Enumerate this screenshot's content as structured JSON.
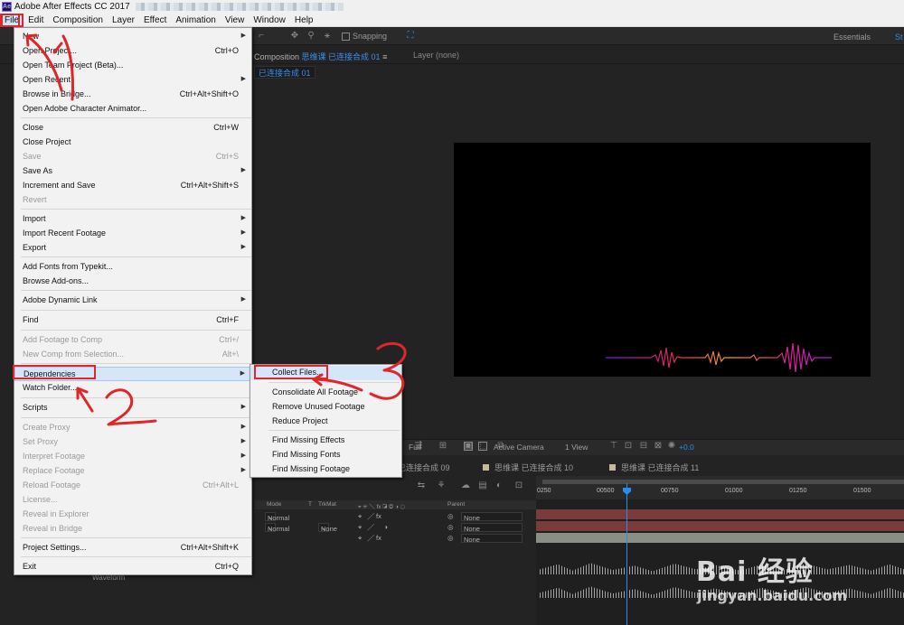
{
  "window": {
    "title": "Adobe After Effects CC 2017",
    "logo": "Ae"
  },
  "menubar": [
    "File",
    "Edit",
    "Composition",
    "Layer",
    "Effect",
    "Animation",
    "View",
    "Window",
    "Help"
  ],
  "toolbar": {
    "snapping": "Snapping",
    "workspace": "Essentials",
    "workspace_next": "St"
  },
  "comp_panel": {
    "tab_prefix": "Composition",
    "tab_name": "思维课 已连接合成 01",
    "menu_icon": "≡",
    "layer_tab": "Layer (none)",
    "sub_tab": "已连接合成 01"
  },
  "viewer_controls": {
    "resolution": "Full",
    "camera": "Active Camera",
    "views": "1 View",
    "exposure": "+0.0"
  },
  "timeline": {
    "tabs": [
      "已连接合成 09",
      "思维课 已连接合成 10",
      "思维课 已连接合成 11"
    ],
    "columns": {
      "mode": "Mode",
      "t": "T",
      "trkmat": "TrkMat",
      "parent": "Parent"
    },
    "rows": [
      {
        "mode": "Normal",
        "trkmat": "",
        "parent": "None"
      },
      {
        "mode": "Normal",
        "trkmat": "None",
        "parent": "None"
      },
      {
        "mode": "",
        "trkmat": "",
        "parent": "None"
      }
    ],
    "ruler": [
      "0250",
      "00500",
      "00750",
      "01000",
      "01250",
      "01500"
    ],
    "waveform_label": "Waveform"
  },
  "file_menu": {
    "items": [
      {
        "label": "New",
        "shortcut": "",
        "submenu": true,
        "disabled": false
      },
      {
        "label": "Open Project...",
        "shortcut": "Ctrl+O",
        "submenu": false,
        "disabled": false
      },
      {
        "label": "Open Team Project (Beta)...",
        "shortcut": "",
        "submenu": false,
        "disabled": false
      },
      {
        "label": "Open Recent",
        "shortcut": "",
        "submenu": true,
        "disabled": false
      },
      {
        "label": "Browse in Bridge...",
        "shortcut": "Ctrl+Alt+Shift+O",
        "submenu": false,
        "disabled": false
      },
      {
        "label": "Open Adobe Character Animator...",
        "shortcut": "",
        "submenu": false,
        "disabled": false
      },
      {
        "label": "Close",
        "shortcut": "Ctrl+W",
        "submenu": false,
        "disabled": false
      },
      {
        "label": "Close Project",
        "shortcut": "",
        "submenu": false,
        "disabled": false
      },
      {
        "label": "Save",
        "shortcut": "Ctrl+S",
        "submenu": false,
        "disabled": true
      },
      {
        "label": "Save As",
        "shortcut": "",
        "submenu": true,
        "disabled": false
      },
      {
        "label": "Increment and Save",
        "shortcut": "Ctrl+Alt+Shift+S",
        "submenu": false,
        "disabled": false
      },
      {
        "label": "Revert",
        "shortcut": "",
        "submenu": false,
        "disabled": true
      },
      {
        "label": "Import",
        "shortcut": "",
        "submenu": true,
        "disabled": false
      },
      {
        "label": "Import Recent Footage",
        "shortcut": "",
        "submenu": true,
        "disabled": false
      },
      {
        "label": "Export",
        "shortcut": "",
        "submenu": true,
        "disabled": false
      },
      {
        "label": "Add Fonts from Typekit...",
        "shortcut": "",
        "submenu": false,
        "disabled": false
      },
      {
        "label": "Browse Add-ons...",
        "shortcut": "",
        "submenu": false,
        "disabled": false
      },
      {
        "label": "Adobe Dynamic Link",
        "shortcut": "",
        "submenu": true,
        "disabled": false
      },
      {
        "label": "Find",
        "shortcut": "Ctrl+F",
        "submenu": false,
        "disabled": false
      },
      {
        "label": "Add Footage to Comp",
        "shortcut": "Ctrl+/",
        "submenu": false,
        "disabled": true
      },
      {
        "label": "New Comp from Selection...",
        "shortcut": "Alt+\\",
        "submenu": false,
        "disabled": true
      },
      {
        "label": "Dependencies",
        "shortcut": "",
        "submenu": true,
        "disabled": false
      },
      {
        "label": "Watch Folder...",
        "shortcut": "",
        "submenu": false,
        "disabled": false
      },
      {
        "label": "Scripts",
        "shortcut": "",
        "submenu": true,
        "disabled": false
      },
      {
        "label": "Create Proxy",
        "shortcut": "",
        "submenu": true,
        "disabled": true
      },
      {
        "label": "Set Proxy",
        "shortcut": "",
        "submenu": true,
        "disabled": true
      },
      {
        "label": "Interpret Footage",
        "shortcut": "",
        "submenu": true,
        "disabled": true
      },
      {
        "label": "Replace Footage",
        "shortcut": "",
        "submenu": true,
        "disabled": true
      },
      {
        "label": "Reload Footage",
        "shortcut": "Ctrl+Alt+L",
        "submenu": false,
        "disabled": true
      },
      {
        "label": "License...",
        "shortcut": "",
        "submenu": false,
        "disabled": true
      },
      {
        "label": "Reveal in Explorer",
        "shortcut": "",
        "submenu": false,
        "disabled": true
      },
      {
        "label": "Reveal in Bridge",
        "shortcut": "",
        "submenu": false,
        "disabled": true
      },
      {
        "label": "Project Settings...",
        "shortcut": "Ctrl+Alt+Shift+K",
        "submenu": false,
        "disabled": false
      },
      {
        "label": "Exit",
        "shortcut": "Ctrl+Q",
        "submenu": false,
        "disabled": false
      }
    ]
  },
  "dependencies_menu": {
    "items": [
      "Collect Files...",
      "Consolidate All Footage",
      "Remove Unused Footage",
      "Reduce Project",
      "Find Missing Effects",
      "Find Missing Fonts",
      "Find Missing Footage"
    ]
  },
  "annotations": {
    "step1": "1",
    "step2": "2",
    "step3": "3",
    "color": "#e0262b"
  },
  "watermark": {
    "brand": "Bai 经验",
    "url": "jingyan.baidu.com"
  },
  "colors": {
    "accent_blue": "#2d8ceb",
    "highlight": "#d4e6f8"
  }
}
